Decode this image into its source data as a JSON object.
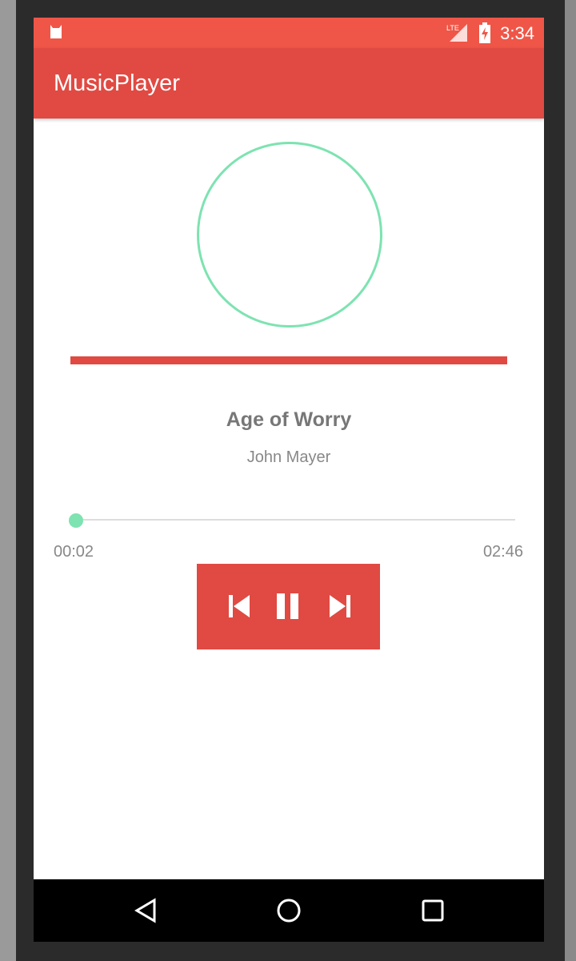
{
  "status_bar": {
    "time": "3:34",
    "network": "LTE",
    "icons": [
      "android-debug-icon",
      "lte-signal-icon",
      "battery-charging-icon"
    ]
  },
  "app_bar": {
    "title": "MusicPlayer"
  },
  "colors": {
    "primary": "#E04A43",
    "status_bar": "#EF5647",
    "accent": "#7DE3B1"
  },
  "player": {
    "song_title": "Age of Worry",
    "artist": "John Mayer",
    "elapsed": "00:02",
    "duration": "02:46",
    "progress_percent": 1.2,
    "controls": [
      "previous-icon",
      "pause-icon",
      "next-icon"
    ]
  },
  "nav_bar": [
    "back-icon",
    "home-icon",
    "recents-icon"
  ]
}
